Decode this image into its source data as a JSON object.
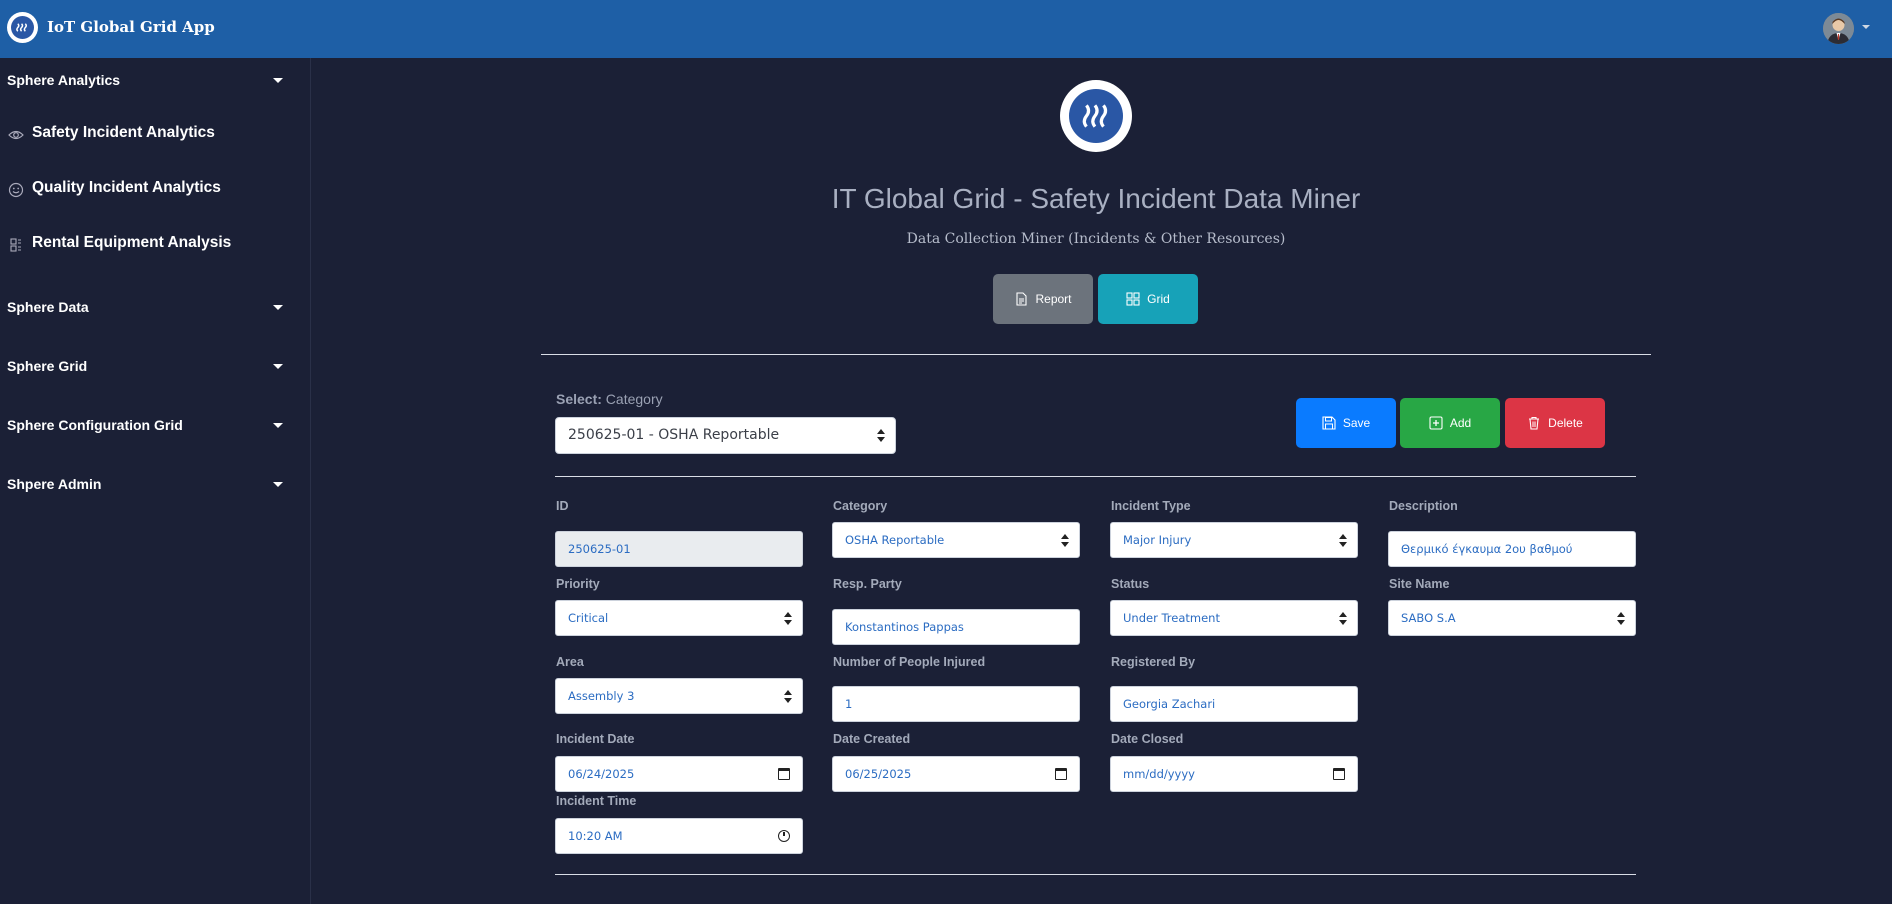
{
  "app": {
    "title": "IoT Global Grid App"
  },
  "sidebar": {
    "sections": [
      {
        "label": "Sphere Analytics"
      },
      {
        "label": "Sphere Data"
      },
      {
        "label": "Sphere Grid"
      },
      {
        "label": "Sphere Configuration Grid"
      },
      {
        "label": "Shpere Admin"
      }
    ],
    "items": [
      {
        "label": "Safety Incident Analytics",
        "icon": "eye-icon"
      },
      {
        "label": "Quality Incident Analytics",
        "icon": "smiley-icon"
      },
      {
        "label": "Rental Equipment Analysis",
        "icon": "tool-icon"
      }
    ]
  },
  "header": {
    "title": "IT Global Grid - Safety Incident Data Miner",
    "subtitle": "Data Collection Miner (Incidents & Other Resources)"
  },
  "view_buttons": {
    "report": "Report",
    "grid": "Grid"
  },
  "selector": {
    "label_bold": "Select:",
    "label_rest": " Category",
    "value": "250625-01 - OSHA Reportable"
  },
  "actions": {
    "save": "Save",
    "add": "Add",
    "delete": "Delete"
  },
  "form": {
    "id": {
      "label": "ID",
      "value": "250625-01"
    },
    "category": {
      "label": "Category",
      "value": "OSHA Reportable"
    },
    "incident_type": {
      "label": "Incident Type",
      "value": "Major Injury"
    },
    "description": {
      "label": "Description",
      "value": "Θερμικό έγκαυμα 2ου βαθμού"
    },
    "priority": {
      "label": "Priority",
      "value": "Critical"
    },
    "resp_party": {
      "label": "Resp. Party",
      "value": "Konstantinos Pappas"
    },
    "status": {
      "label": "Status",
      "value": "Under Treatment"
    },
    "site_name": {
      "label": "Site Name",
      "value": "SABO S.A"
    },
    "area": {
      "label": "Area",
      "value": "Assembly 3"
    },
    "people_injured": {
      "label": "Number of People Injured",
      "value": "1"
    },
    "registered_by": {
      "label": "Registered By",
      "value": "Georgia Zachari"
    },
    "incident_date": {
      "label": "Incident Date",
      "value": "06/24/2025"
    },
    "date_created": {
      "label": "Date Created",
      "value": "06/25/2025"
    },
    "date_closed": {
      "label": "Date Closed",
      "value": "mm/dd/yyyy"
    },
    "incident_time": {
      "label": "Incident Time",
      "value": "10:20 AM"
    }
  },
  "colors": {
    "topbar": "#1e5fa6",
    "background": "#1b2036",
    "save": "#0a7bff",
    "add": "#28a745",
    "delete": "#dc3545",
    "grid": "#17a2b8",
    "report": "#6c737c"
  }
}
